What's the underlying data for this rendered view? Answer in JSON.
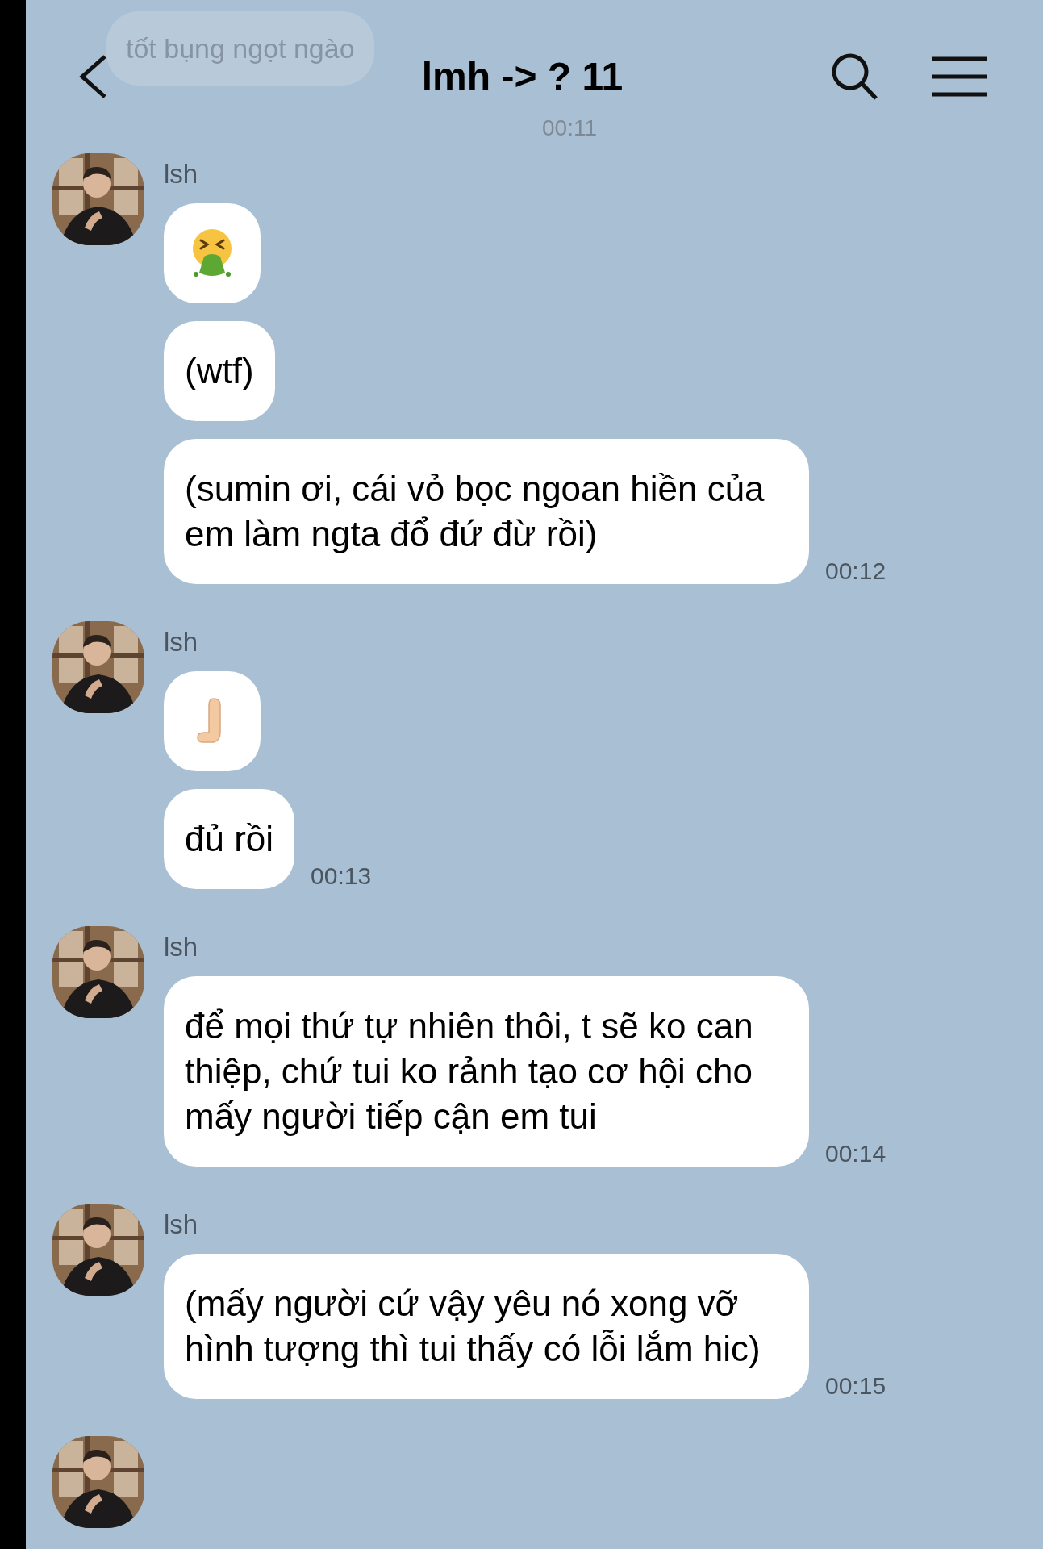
{
  "header": {
    "title": "lmh -> ? 11"
  },
  "ghost_message": {
    "text": "tốt bụng ngọt ngào",
    "time": "00:11"
  },
  "groups": [
    {
      "sender": "lsh",
      "time": "00:12",
      "messages": [
        {
          "kind": "vomit"
        },
        {
          "kind": "text",
          "text": "(wtf)"
        },
        {
          "kind": "text",
          "text": "(sumin ơi, cái vỏ bọc ngoan hiền của em làm ngta đổ đứ đừ rồi)"
        }
      ]
    },
    {
      "sender": "lsh",
      "time": "00:13",
      "messages": [
        {
          "kind": "palm"
        },
        {
          "kind": "text",
          "text": "đủ rồi"
        }
      ]
    },
    {
      "sender": "lsh",
      "time": "00:14",
      "messages": [
        {
          "kind": "text",
          "text": "để mọi thứ tự nhiên thôi, t sẽ ko can thiệp, chứ tui ko rảnh tạo cơ hội cho mấy người tiếp cận em tui"
        }
      ]
    },
    {
      "sender": "lsh",
      "time": "00:15",
      "messages": [
        {
          "kind": "text",
          "text": "(mấy người cứ vậy yêu nó xong vỡ hình tượng thì tui thấy có lỗi lắm hic)"
        }
      ]
    }
  ]
}
